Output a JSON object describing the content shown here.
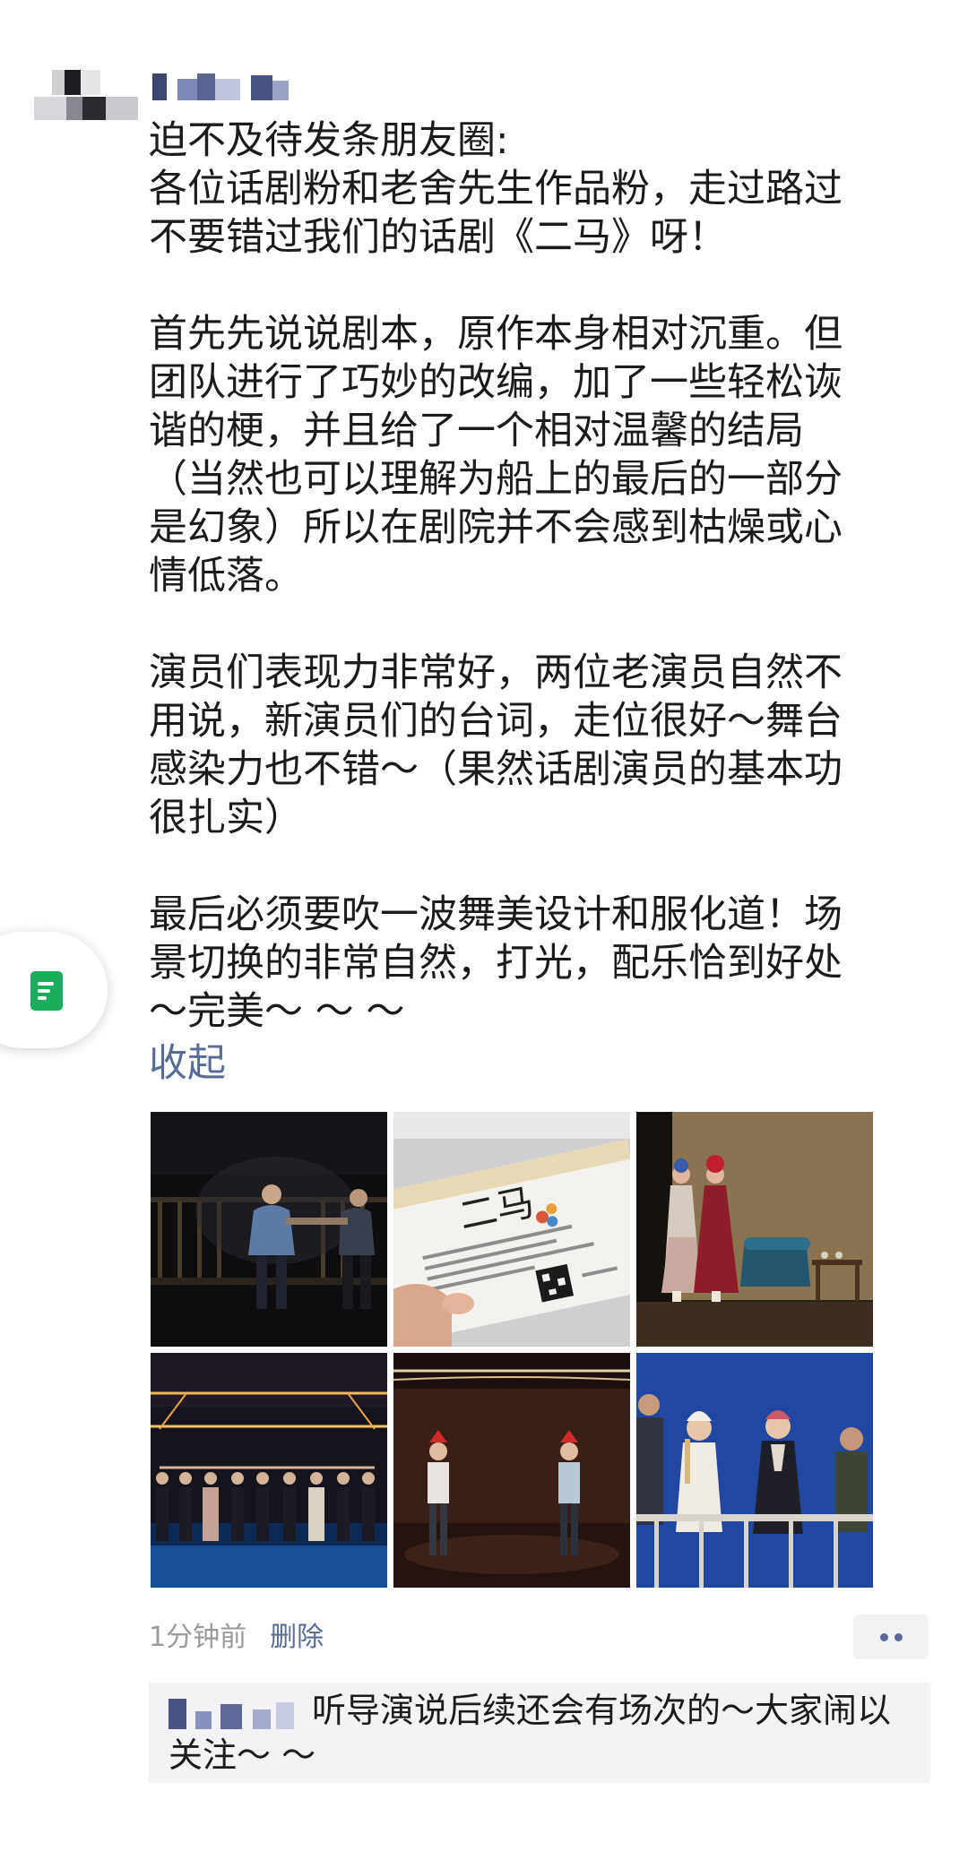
{
  "post": {
    "paragraphs": [
      [
        "迫不及待发条朋友圈:",
        "各位话剧粉和老舍先生作品粉，走过路过",
        "不要错过我们的话剧《二马》呀！"
      ],
      [
        "首先先说说剧本，原作本身相对沉重。但",
        "团队进行了巧妙的改编，加了一些轻松诙",
        "谐的梗，并且给了一个相对温馨的结局",
        "（当然也可以理解为船上的最后的一部分",
        "是幻象）所以在剧院并不会感到枯燥或心",
        "情低落。"
      ],
      [
        "演员们表现力非常好，两位老演员自然不",
        "用说，新演员们的台词，走位很好～舞台",
        "感染力也不错～（果然话剧演员的基本功",
        "很扎实）"
      ],
      [
        "最后必须要吹一波舞美设计和服化道！场",
        "景切换的非常自然，打光，配乐恰到好处",
        "～完美～ ～ ～"
      ]
    ],
    "collapse_label": "收起"
  },
  "photos": [
    {
      "name": "photo-stage-handshake"
    },
    {
      "name": "photo-ticket"
    },
    {
      "name": "photo-stage-actresses"
    },
    {
      "name": "photo-curtain-call"
    },
    {
      "name": "photo-stage-duo"
    },
    {
      "name": "photo-ship-scene"
    }
  ],
  "ticket": {
    "title": "二马"
  },
  "meta": {
    "time": "1分钟前",
    "delete_label": "删除"
  },
  "comment": {
    "text": "听导演说后续还会有场次的～大家闹以关注～ ～"
  },
  "colors": {
    "link": "#576b95",
    "text": "#1b1b1b",
    "meta": "#9a9a9a",
    "doc_icon": "#1aad5c"
  },
  "icons": {
    "side_widget": "document-icon",
    "more": "more-dots-icon"
  }
}
